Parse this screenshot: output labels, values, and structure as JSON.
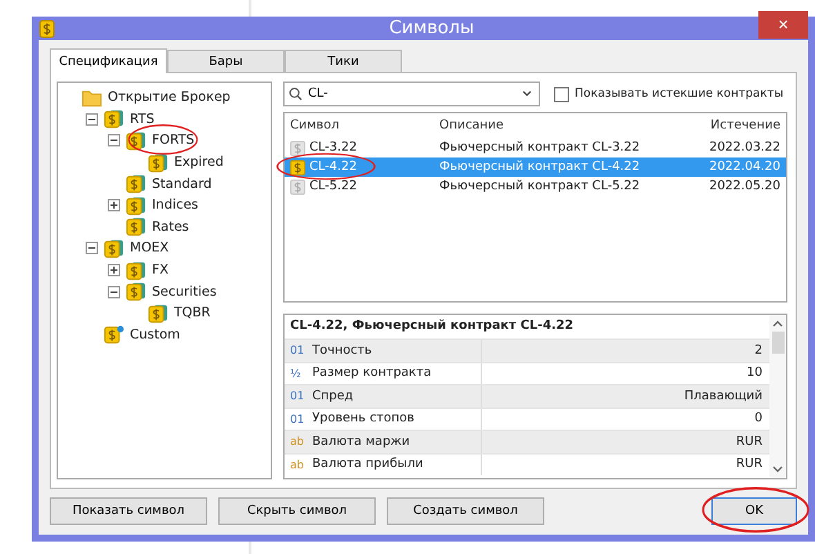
{
  "window": {
    "title": "Символы",
    "close": "×"
  },
  "tabs": [
    {
      "label": "Спецификация",
      "selected": true
    },
    {
      "label": "Бары",
      "selected": false
    },
    {
      "label": "Тики",
      "selected": false
    }
  ],
  "tree": [
    {
      "label": "Открытие Брокер",
      "kind": "folder",
      "children": [
        {
          "label": "RTS",
          "kind": "group",
          "expanded": true,
          "children": [
            {
              "label": "FORTS",
              "kind": "group",
              "expanded": true,
              "circled": true,
              "children": [
                {
                  "label": "Expired",
                  "kind": "group"
                }
              ]
            },
            {
              "label": "Standard",
              "kind": "group"
            },
            {
              "label": "Indices",
              "kind": "group",
              "expanded": false
            },
            {
              "label": "Rates",
              "kind": "group"
            }
          ]
        },
        {
          "label": "MOEX",
          "kind": "group",
          "expanded": true,
          "children": [
            {
              "label": "FX",
              "kind": "group",
              "expanded": false
            },
            {
              "label": "Securities",
              "kind": "group",
              "expanded": true,
              "children": [
                {
                  "label": "TQBR",
                  "kind": "group"
                }
              ]
            }
          ]
        },
        {
          "label": "Custom",
          "kind": "custom"
        }
      ]
    }
  ],
  "search": {
    "value": "CL-"
  },
  "show_expired": {
    "label": "Показывать истекшие контракты",
    "checked": false
  },
  "table": {
    "columns": [
      "Символ",
      "Описание",
      "Истечение"
    ],
    "rows": [
      {
        "symbol": "CL-3.22",
        "description": "Фьючерсный контракт CL-3.22",
        "expiry": "2022.03.22",
        "active": false,
        "selected": false,
        "circled": false
      },
      {
        "symbol": "CL-4.22",
        "description": "Фьючерсный контракт CL-4.22",
        "expiry": "2022.04.20",
        "active": true,
        "selected": true,
        "circled": true
      },
      {
        "symbol": "CL-5.22",
        "description": "Фьючерсный контракт CL-5.22",
        "expiry": "2022.05.20",
        "active": false,
        "selected": false,
        "circled": false
      }
    ]
  },
  "details": {
    "title": "CL-4.22, Фьючерсный контракт CL-4.22",
    "rows": [
      {
        "kind": "number",
        "badge": "01",
        "name": "Точность",
        "value": "2"
      },
      {
        "kind": "fraction",
        "badge": "½",
        "name": "Размер контракта",
        "value": "10"
      },
      {
        "kind": "number",
        "badge": "01",
        "name": "Спред",
        "value": "Плавающий"
      },
      {
        "kind": "number",
        "badge": "01",
        "name": "Уровень стопов",
        "value": "0"
      },
      {
        "kind": "text",
        "badge": "ab",
        "name": "Валюта маржи",
        "value": "RUR"
      },
      {
        "kind": "text",
        "badge": "ab",
        "name": "Валюта прибыли",
        "value": "RUR"
      }
    ]
  },
  "buttons": [
    {
      "label": "Показать символ",
      "kind": "action"
    },
    {
      "label": "Скрыть символ",
      "kind": "action"
    },
    {
      "label": "Создать символ",
      "kind": "action"
    },
    {
      "label": "OK",
      "kind": "default",
      "circled": true
    }
  ]
}
